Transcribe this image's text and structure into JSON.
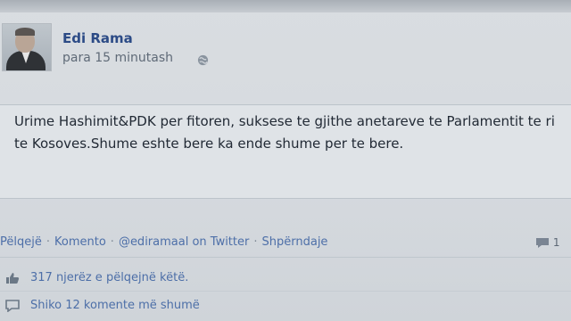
{
  "post": {
    "author": "Edi Rama",
    "timestamp": "para 15 minutash",
    "text": "Urime Hashimit&PDK per fitoren, suksese te gjithe anetareve te Parlamentit te ri te Kosoves.Shume eshte bere ka ende shume per te bere."
  },
  "actions": {
    "like": "Pëlqejë",
    "comment": "Komento",
    "via": "@ediramaal on Twitter",
    "share": "Shpërndaje",
    "comment_count": "1"
  },
  "likes_text": "317 njerëz e pëlqejnë këtë.",
  "more_comments": "Shiko 12 komente më shumë",
  "icons": [
    "avatar",
    "globe-icon",
    "comment-bubble-icon",
    "thumbs-up-icon",
    "comment-icon"
  ],
  "colors": {
    "link": "#4d6fa8",
    "author": "#2c4b86",
    "background": "#d6dadf"
  }
}
